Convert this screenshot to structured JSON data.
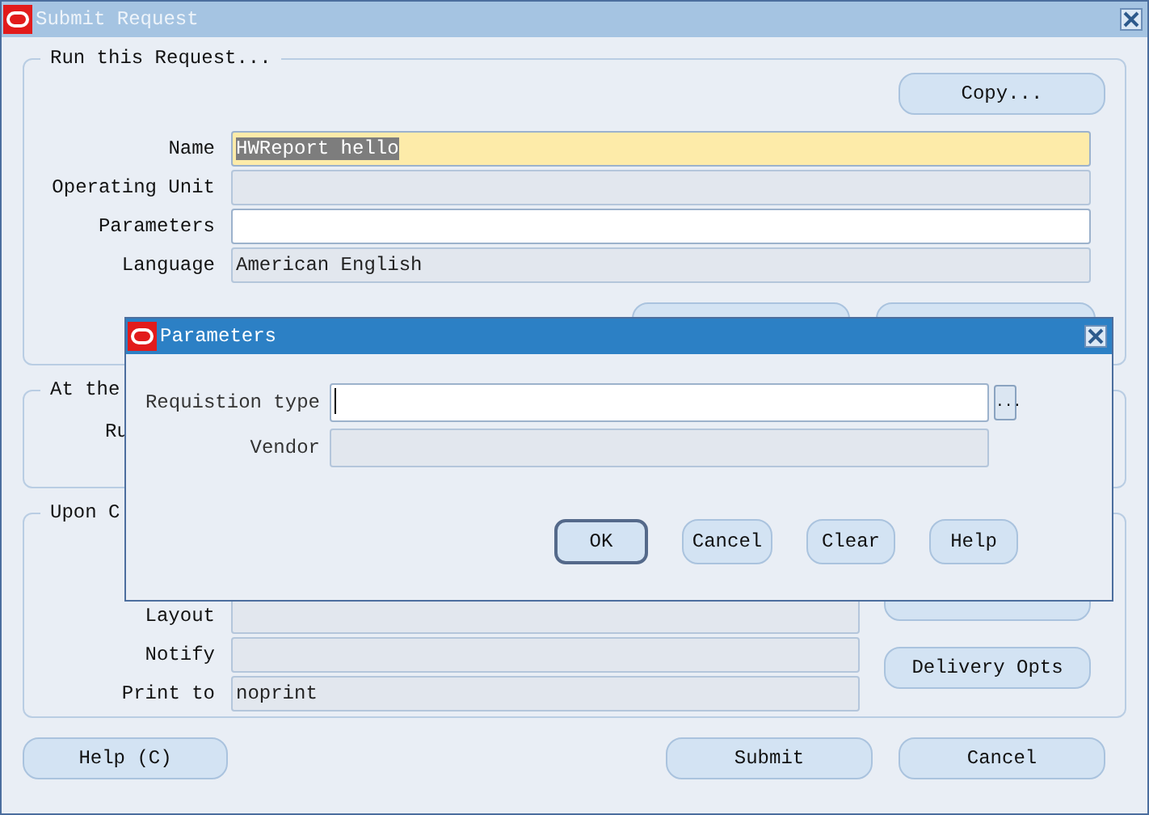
{
  "window": {
    "title": "Submit Request"
  },
  "run_request": {
    "legend": "Run this Request...",
    "copy_button": "Copy...",
    "fields": [
      {
        "label": "Name",
        "value": "HWReport hello",
        "required": true,
        "focused": true,
        "disabled": false
      },
      {
        "label": "Operating Unit",
        "required": false,
        "focused": false,
        "disabled": true
      },
      {
        "label": "Parameters",
        "required": false,
        "focused": false,
        "disabled": false
      },
      {
        "label": "Language",
        "value": "American English",
        "required": false,
        "focused": false,
        "disabled": true
      }
    ]
  },
  "schedule": {
    "legend": "At the",
    "row_label": "Ru"
  },
  "completion": {
    "legend": "Upon C",
    "delivery_button": "Delivery Opts",
    "fields": [
      {
        "label": "Layout",
        "required": false,
        "focused": false,
        "disabled": true
      },
      {
        "label": "Notify",
        "required": false,
        "focused": false,
        "disabled": true
      },
      {
        "label": "Print to",
        "value": "noprint",
        "required": false,
        "focused": false,
        "disabled": true
      }
    ]
  },
  "buttons": [
    {
      "label": "Help (C)"
    },
    {
      "label": "Submit"
    },
    {
      "label": "Cancel"
    }
  ],
  "dialog": {
    "title": "Parameters",
    "lov_button": "...",
    "fields": [
      {
        "label": "Requistion type",
        "required": false,
        "focused": true,
        "disabled": false,
        "lov": true
      },
      {
        "label": "Vendor",
        "required": false,
        "focused": false,
        "disabled": true,
        "lov": false
      }
    ],
    "buttons": [
      {
        "label": "OK",
        "default": true
      },
      {
        "label": "Cancel",
        "default": false
      },
      {
        "label": "Clear",
        "default": false
      },
      {
        "label": "Help",
        "default": false
      }
    ]
  }
}
